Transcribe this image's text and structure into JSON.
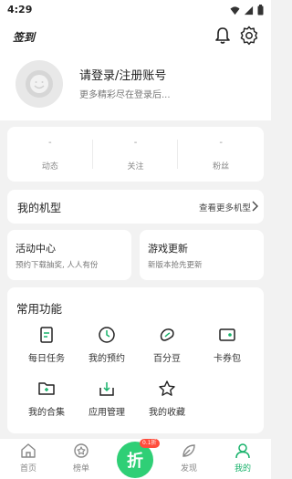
{
  "status": {
    "time": "4:29"
  },
  "header": {
    "checkin_label": "签到"
  },
  "profile": {
    "login_title": "请登录/注册账号",
    "login_subtitle": "更多精彩尽在登录后..."
  },
  "stats": [
    {
      "value": "-",
      "label": "动态"
    },
    {
      "value": "-",
      "label": "关注"
    },
    {
      "value": "-",
      "label": "粉丝"
    }
  ],
  "models": {
    "title": "我的机型",
    "more_label": "查看更多机型"
  },
  "cards": [
    {
      "title": "活动中心",
      "subtitle": "预约下载抽奖, 人人有份"
    },
    {
      "title": "游戏更新",
      "subtitle": "新版本抢先更新"
    }
  ],
  "functions": {
    "title": "常用功能",
    "items": [
      {
        "label": "每日任务",
        "icon": "task-icon"
      },
      {
        "label": "我的预约",
        "icon": "clock-icon"
      },
      {
        "label": "百分豆",
        "icon": "bean-icon"
      },
      {
        "label": "卡券包",
        "icon": "coupon-icon"
      },
      {
        "label": "我的合集",
        "icon": "folder-icon"
      },
      {
        "label": "应用管理",
        "icon": "download-box-icon"
      },
      {
        "label": "我的收藏",
        "icon": "star-icon"
      }
    ]
  },
  "tabbar": {
    "items": [
      {
        "label": "首页",
        "icon": "home-icon"
      },
      {
        "label": "榜单",
        "icon": "rank-icon"
      },
      {
        "label": "发现",
        "icon": "discover-icon"
      },
      {
        "label": "我的",
        "icon": "person-icon",
        "active": true
      }
    ],
    "center_label": "折",
    "center_badge": "0.1折"
  },
  "colors": {
    "accent": "#17b26a",
    "center_button": "#2fcf76",
    "badge": "#ff4d3d"
  }
}
